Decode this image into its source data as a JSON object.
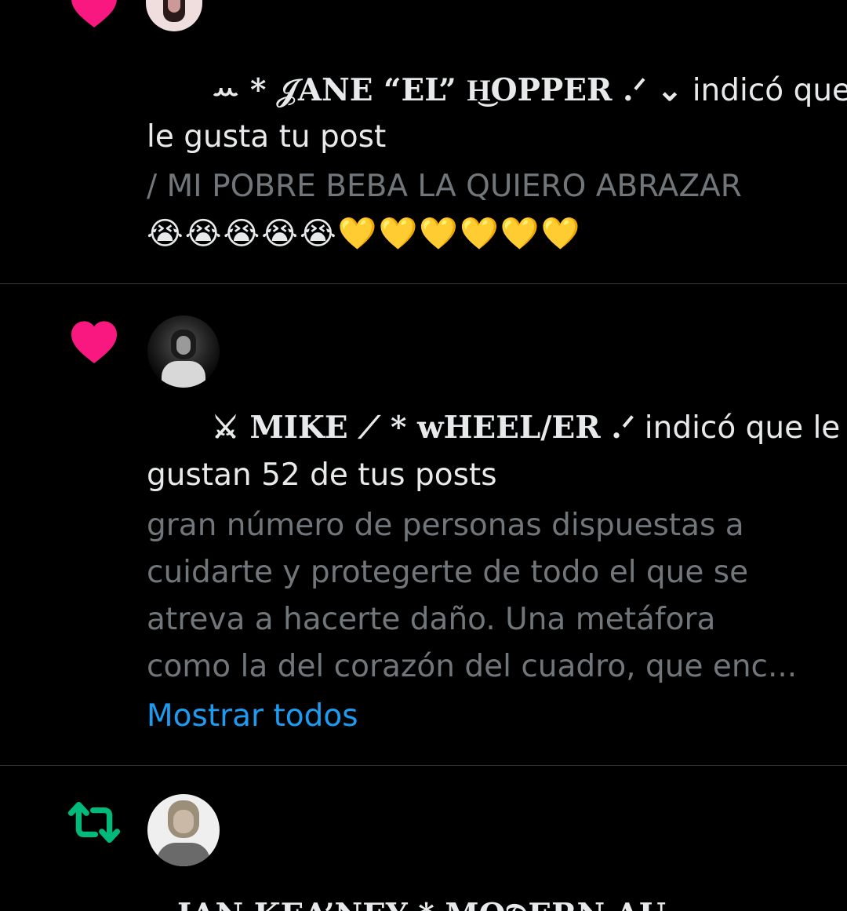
{
  "colors": {
    "background": "#000000",
    "text": "#e7e9ea",
    "muted": "#71767b",
    "link": "#1d9bf0",
    "like": "#f91880",
    "repost": "#00ba7c",
    "divider": "#2f3336"
  },
  "notifications": [
    {
      "type": "like",
      "icon": "heart-icon",
      "name": "ꕀ * 𝒥ANE “EL” H͜OPPER .ᐟ ⌄",
      "action_line1": "indicó que",
      "action_line2": "le gusta tu post",
      "post_line1": "/ MI POBRE BEBA LA QUIERO ABRAZAR",
      "post_line2": "😭😭😭😭😭💛💛💛💛💛💛"
    },
    {
      "type": "like",
      "icon": "heart-icon",
      "name": "⚔ MIKE ⟋ * ᴡHEEL/ER .ᐟ",
      "action_line1": "indicó que le",
      "action_line2": "gustan 52 de tus posts",
      "post_lines": [
        "gran número de personas dispuestas a",
        "cuidarte y protegerte de todo el que se",
        "atreva a hacerte daño. Una metáfora",
        "como la del corazón del cuadro, que enc..."
      ],
      "show_all": "Mostrar todos"
    },
    {
      "type": "repost",
      "icon": "repost-icon",
      "name_partial": "IAN KEA’NEY * MO𝔇ERN AU"
    }
  ]
}
